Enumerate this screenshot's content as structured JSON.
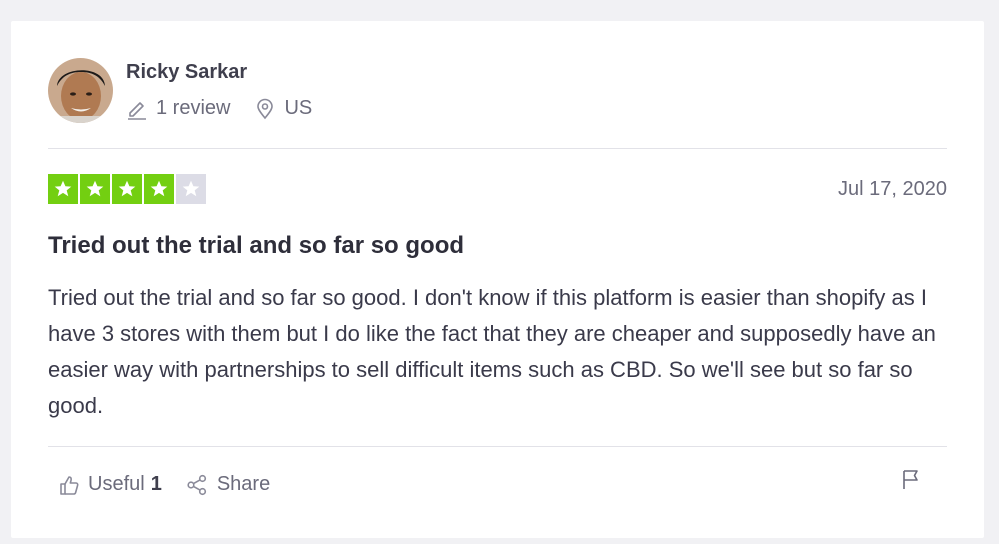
{
  "reviewer": {
    "name": "Ricky Sarkar",
    "review_count": "1 review",
    "country": "US"
  },
  "review": {
    "rating": 4,
    "rating_max": 5,
    "date": "Jul 17, 2020",
    "title": "Tried out the trial and so far so good",
    "body": "Tried out the trial and so far so good. I don't know if this platform is easier than shopify as I have 3 stores with them but I do like the fact that they are cheaper and supposedly have an easier way with partnerships to sell difficult items such as CBD. So we'll see but so far so good."
  },
  "actions": {
    "useful_label": "Useful",
    "useful_count": "1",
    "share_label": "Share"
  },
  "colors": {
    "star_filled": "#73cf11",
    "star_empty": "#dcdce6",
    "card_bg": "#ffffff",
    "page_bg": "#f1f1f4"
  },
  "icons": {
    "edit": "pencil-icon",
    "location": "location-pin-icon",
    "useful": "thumbs-up-icon",
    "share": "share-icon",
    "report": "flag-icon"
  }
}
